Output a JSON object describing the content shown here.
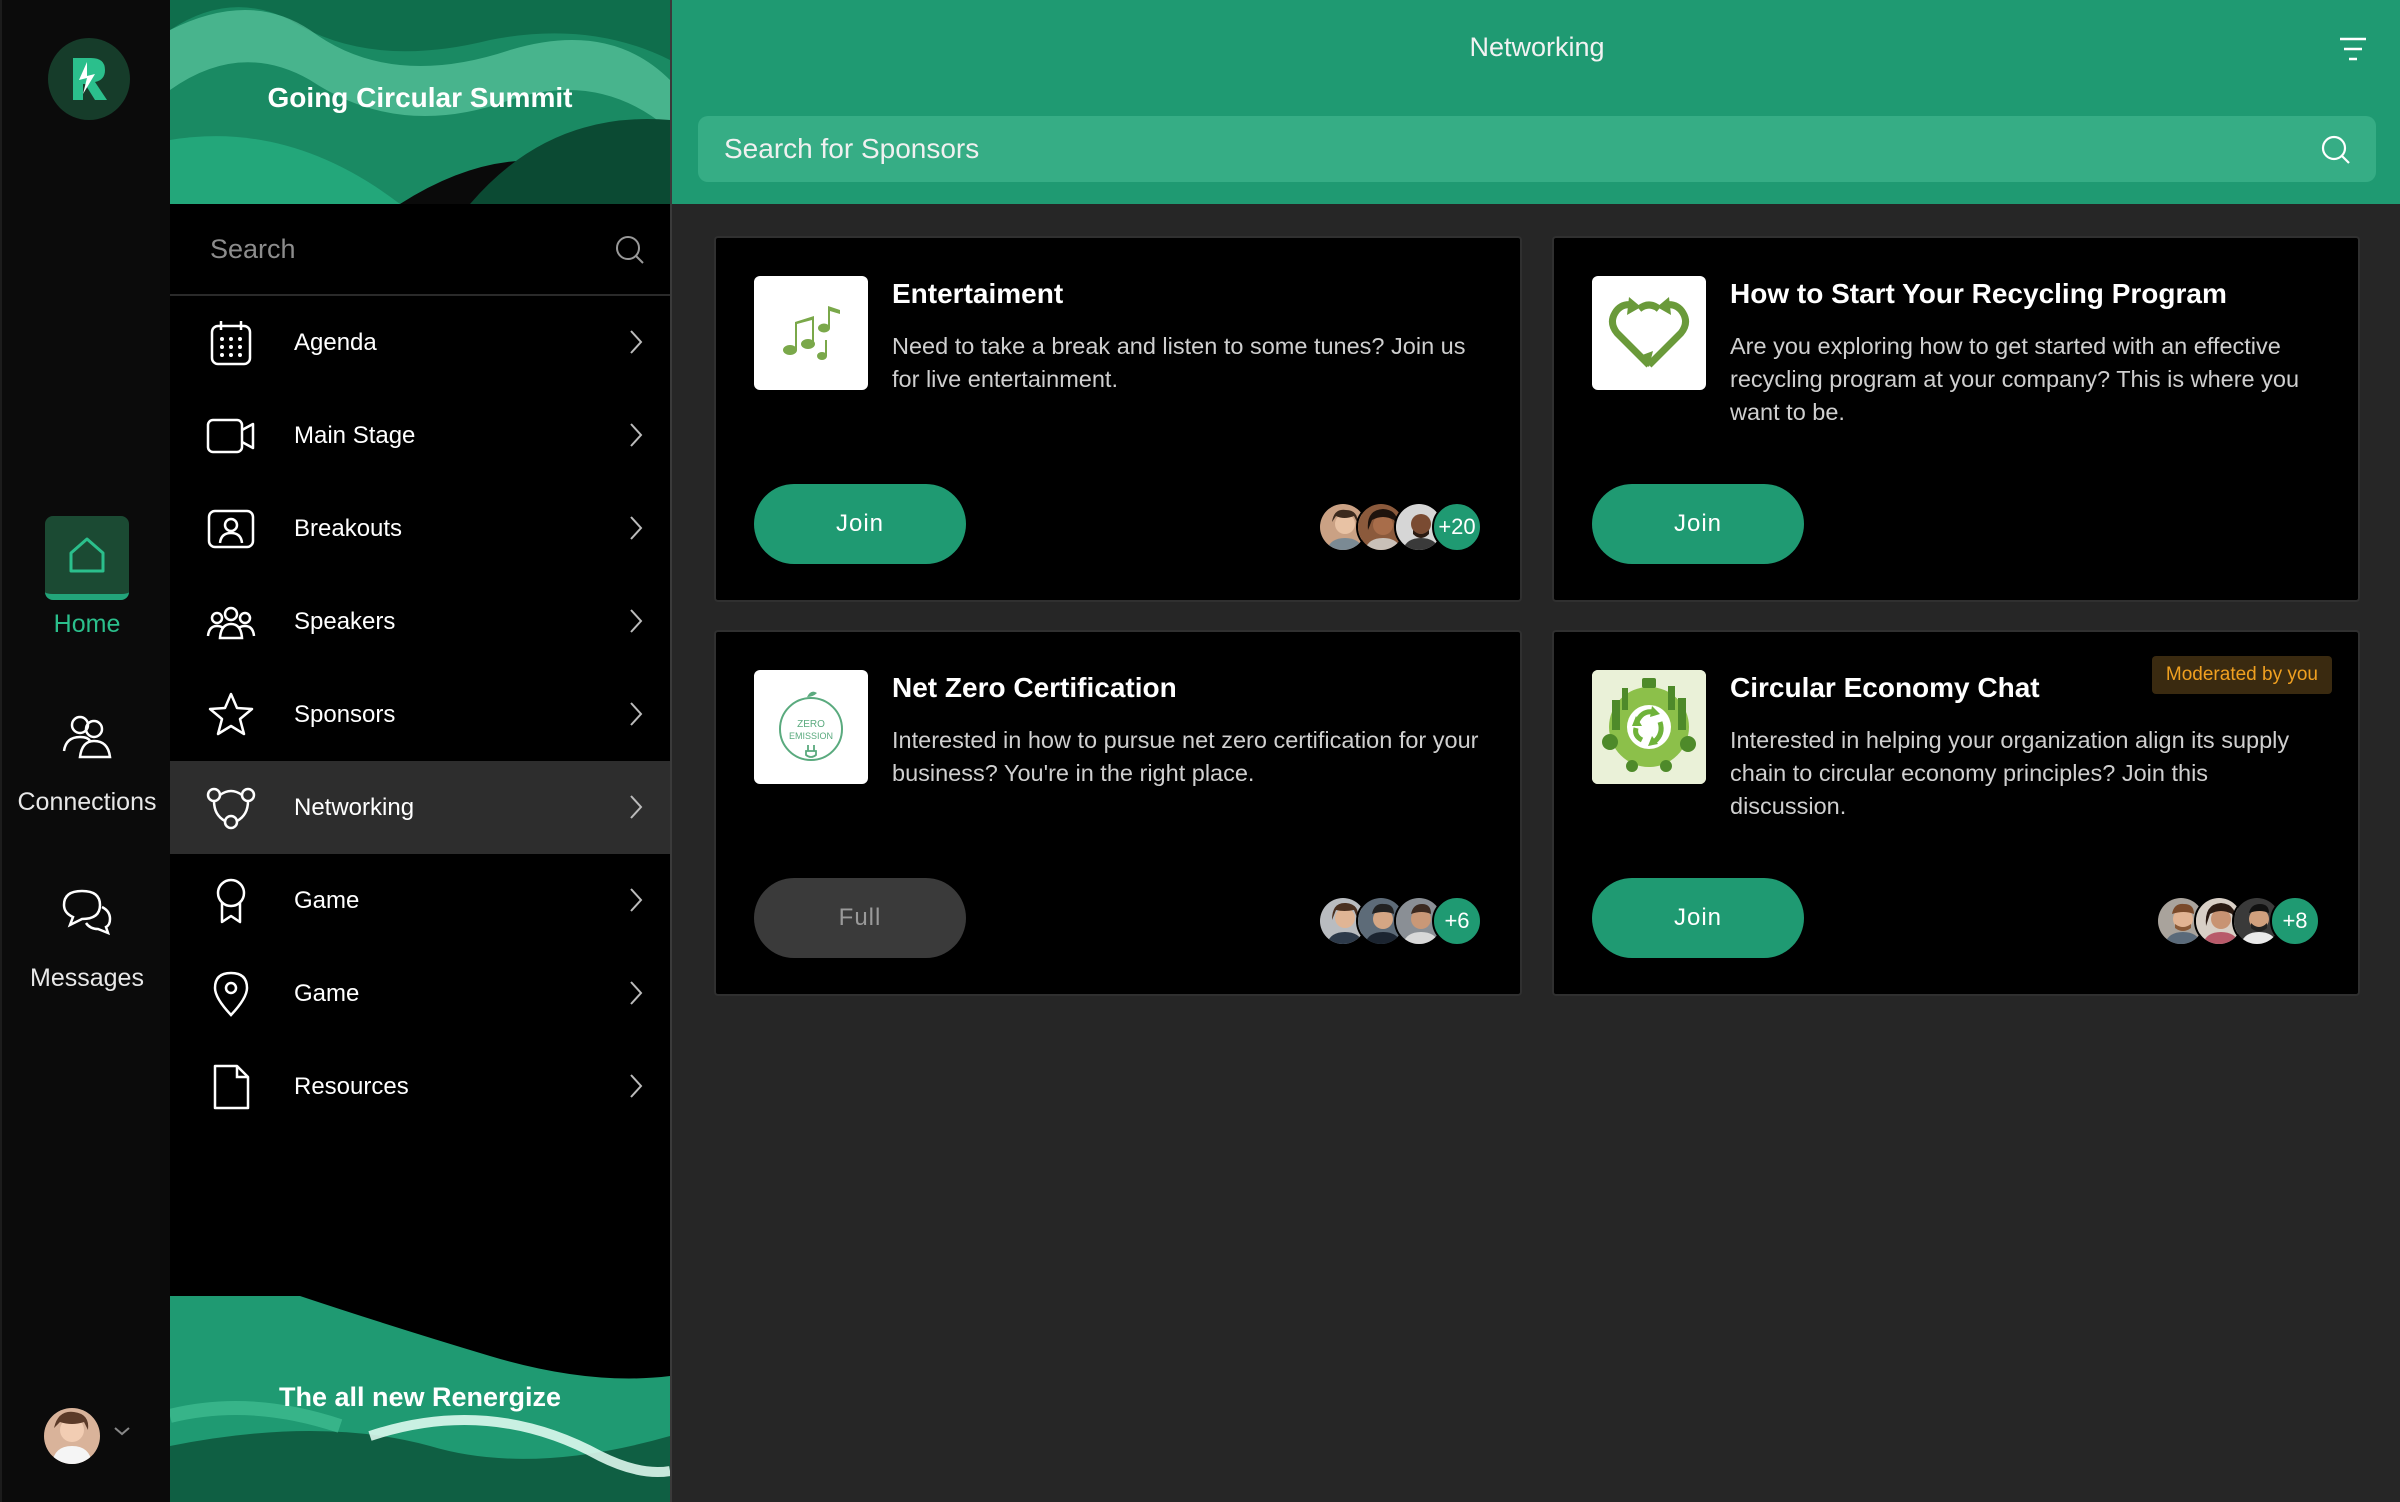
{
  "rail": {
    "items": [
      {
        "label": "Home"
      },
      {
        "label": "Connections"
      },
      {
        "label": "Messages"
      }
    ]
  },
  "nav": {
    "event_title": "Going Circular Summit",
    "search_placeholder": "Search",
    "items": [
      {
        "label": "Agenda",
        "icon": "calendar-icon"
      },
      {
        "label": "Main Stage",
        "icon": "video-icon"
      },
      {
        "label": "Breakouts",
        "icon": "breakout-icon"
      },
      {
        "label": "Speakers",
        "icon": "people-icon"
      },
      {
        "label": "Sponsors",
        "icon": "star-icon"
      },
      {
        "label": "Networking",
        "icon": "networking-icon"
      },
      {
        "label": "Game",
        "icon": "ribbon-icon"
      },
      {
        "label": "Game",
        "icon": "map-pin-icon"
      },
      {
        "label": "Resources",
        "icon": "document-icon"
      }
    ],
    "active_index": 5,
    "footer_title": "The all new Renergize"
  },
  "header": {
    "title": "Networking",
    "search_placeholder": "Search for Sponsors"
  },
  "cards": [
    {
      "title": "Entertaiment",
      "description": "Need to take a break and listen to some tunes? Join us for live entertainment.",
      "button": "Join",
      "button_state": "enabled",
      "attendee_count": "+20",
      "thumbnail_icon": "music-notes-icon"
    },
    {
      "title": "How to Start Your Recycling Program",
      "description": "Are you exploring how to get started with an effective recycling program at your company? This is where you want to be.",
      "button": "Join",
      "button_state": "enabled",
      "attendee_count": "",
      "thumbnail_icon": "recycle-heart-icon"
    },
    {
      "title": "Net Zero Certification",
      "description": "Interested in how to pursue net zero certification for your business? You're in the right place.",
      "button": "Full",
      "button_state": "disabled",
      "attendee_count": "+6",
      "thumbnail_icon": "zero-emission-icon",
      "thumbnail_text": [
        "ZERO",
        "EMISSION"
      ]
    },
    {
      "title": "Circular Economy Chat",
      "description": "Interested in helping your organization align its supply chain to circular economy principles? Join this discussion.",
      "button": "Join",
      "button_state": "enabled",
      "attendee_count": "+8",
      "badge": "Moderated by you",
      "thumbnail_icon": "green-city-recycle-icon"
    }
  ],
  "colors": {
    "accent": "#1f9a72",
    "accent_light": "#36ad85",
    "badge_text": "#f0a020",
    "panel_bg": "#000000",
    "main_bg": "#262626"
  }
}
